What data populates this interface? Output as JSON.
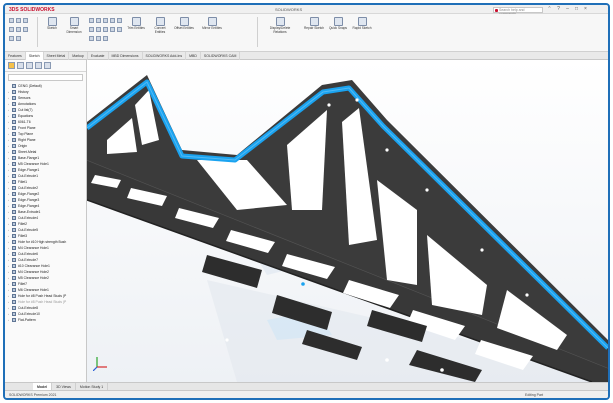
{
  "app": {
    "brand": "3DS SOLIDWORKS",
    "title": "SOLIDWORKS",
    "search_placeholder": "Search help and commands",
    "window_icons": [
      "chevron-up-icon",
      "help-icon",
      "minimize-icon",
      "restore-icon",
      "close-icon"
    ]
  },
  "ribbon": {
    "groups": [
      {
        "label": "Sketch"
      },
      {
        "label": "Smart Dimension"
      },
      {
        "label": "Trim Entities"
      },
      {
        "label": "Convert Entities"
      },
      {
        "label": "Offset Entities"
      },
      {
        "label": "Mirror Entities"
      },
      {
        "label": "Display/Delete Relations"
      },
      {
        "label": "Repair Sketch"
      },
      {
        "label": "Quick Snaps"
      },
      {
        "label": "Rapid Sketch"
      }
    ]
  },
  "command_tabs": [
    "Features",
    "Sketch",
    "Sheet Metal",
    "Markup",
    "Evaluate",
    "MBD Dimensions",
    "SOLIDWORKS Add-Ins",
    "MBD",
    "SOLIDWORKS CAM"
  ],
  "active_command_tab": "Sketch",
  "tree": {
    "items": [
      {
        "label": "CENG (Default)",
        "icon": "part-icon"
      },
      {
        "label": "History",
        "icon": "history-icon"
      },
      {
        "label": "Sensors",
        "icon": "sensor-icon"
      },
      {
        "label": "Annotations",
        "icon": "annotations-icon"
      },
      {
        "label": "Cut list(7)",
        "icon": "cut-list-icon"
      },
      {
        "label": "Equations",
        "icon": "equations-icon"
      },
      {
        "label": "6061-T6",
        "icon": "material-icon"
      },
      {
        "label": "Front Plane",
        "icon": "plane-icon"
      },
      {
        "label": "Top Plane",
        "icon": "plane-icon"
      },
      {
        "label": "Right Plane",
        "icon": "plane-icon"
      },
      {
        "label": "Origin",
        "icon": "origin-icon"
      },
      {
        "label": "Sheet-Metal",
        "icon": "sheet-metal-icon"
      },
      {
        "label": "Base-Flange1",
        "icon": "flange-icon"
      },
      {
        "label": "M5 Clearance Hole1",
        "icon": "hole-icon"
      },
      {
        "label": "Edge-Flange1",
        "icon": "flange-icon"
      },
      {
        "label": "Cut-Extrude1",
        "icon": "cut-icon"
      },
      {
        "label": "Fillet1",
        "icon": "fillet-icon"
      },
      {
        "label": "Cut-Extrude2",
        "icon": "cut-icon"
      },
      {
        "label": "Edge-Flange2",
        "icon": "flange-icon"
      },
      {
        "label": "Edge-Flange3",
        "icon": "flange-icon"
      },
      {
        "label": "Edge-Flange4",
        "icon": "flange-icon"
      },
      {
        "label": "Base-Extrude1",
        "icon": "extrude-icon"
      },
      {
        "label": "Cut-Extrude4",
        "icon": "cut-icon"
      },
      {
        "label": "Fillet2",
        "icon": "fillet-icon"
      },
      {
        "label": "Cut-Extrude5",
        "icon": "cut-icon"
      },
      {
        "label": "Fillet3",
        "icon": "fillet-icon"
      },
      {
        "label": "Hole for #10 High strength Bush",
        "icon": "hole-icon"
      },
      {
        "label": "M4 Clearance Hole1",
        "icon": "hole-icon"
      },
      {
        "label": "Cut-Extrude6",
        "icon": "cut-icon"
      },
      {
        "label": "Cut-Extrude7",
        "icon": "cut-icon"
      },
      {
        "label": "#10 Clearance Hole1",
        "icon": "hole-icon"
      },
      {
        "label": "M4 Clearance Hole2",
        "icon": "hole-icon"
      },
      {
        "label": "M5 Clearance Hole2",
        "icon": "hole-icon"
      },
      {
        "label": "Fillet7",
        "icon": "fillet-icon"
      },
      {
        "label": "M6 Clearance Hole1",
        "icon": "hole-icon"
      },
      {
        "label": "Hole for #8 Push Head Studs (P",
        "icon": "hole-icon"
      },
      {
        "label": "Hole for #8 Push Head Studs (P",
        "icon": "hole-icon",
        "dim": true
      },
      {
        "label": "Cut-Extrude8",
        "icon": "cut-icon"
      },
      {
        "label": "Cut-Extrude10",
        "icon": "cut-icon"
      },
      {
        "label": "Flat-Pattern",
        "icon": "flat-pattern-icon"
      }
    ]
  },
  "viewport": {
    "breadcrumb": "Part1",
    "sketch_label": "Sketch5",
    "accent_blue": "#1aa3f0",
    "part_color": "#3b3b3b"
  },
  "bottom_tabs": [
    "Model",
    "3D Views",
    "Motion Study 1"
  ],
  "active_bottom_tab": "Model",
  "status": {
    "left": "SOLIDWORKS Premium 2021",
    "right": "Editing Part"
  }
}
